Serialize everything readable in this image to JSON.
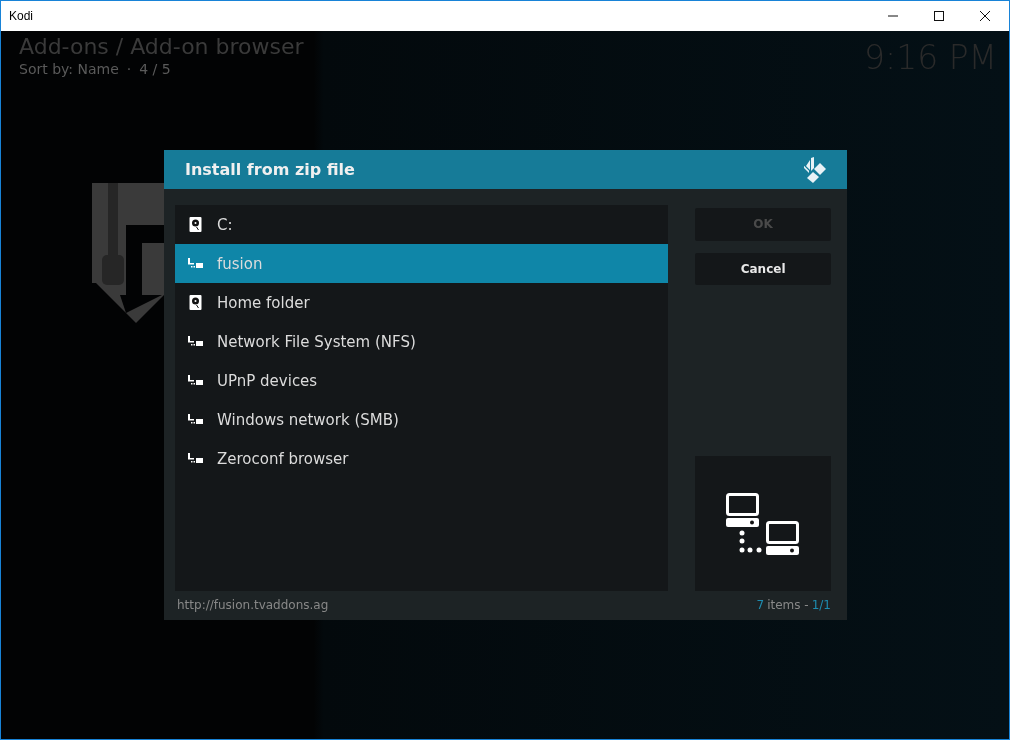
{
  "window": {
    "title": "Kodi"
  },
  "header": {
    "breadcrumb": "Add-ons / Add-on browser",
    "sort": "Sort by: Name",
    "separator": "·",
    "position": "4 / 5",
    "clock": "9:16 PM"
  },
  "dialog": {
    "title": "Install from zip file",
    "items": [
      {
        "label": "C:",
        "kind": "drive",
        "selected": false
      },
      {
        "label": "fusion",
        "kind": "network",
        "selected": true
      },
      {
        "label": "Home folder",
        "kind": "drive",
        "selected": false
      },
      {
        "label": "Network File System (NFS)",
        "kind": "network",
        "selected": false
      },
      {
        "label": "UPnP devices",
        "kind": "network",
        "selected": false
      },
      {
        "label": "Windows network (SMB)",
        "kind": "network",
        "selected": false
      },
      {
        "label": "Zeroconf browser",
        "kind": "network",
        "selected": false
      }
    ],
    "buttons": [
      {
        "label": "OK",
        "disabled": true
      },
      {
        "label": "Cancel",
        "disabled": false
      }
    ],
    "path": "http://fusion.tvaddons.ag",
    "count": "7",
    "count_label": "items -",
    "page": "1/1"
  }
}
